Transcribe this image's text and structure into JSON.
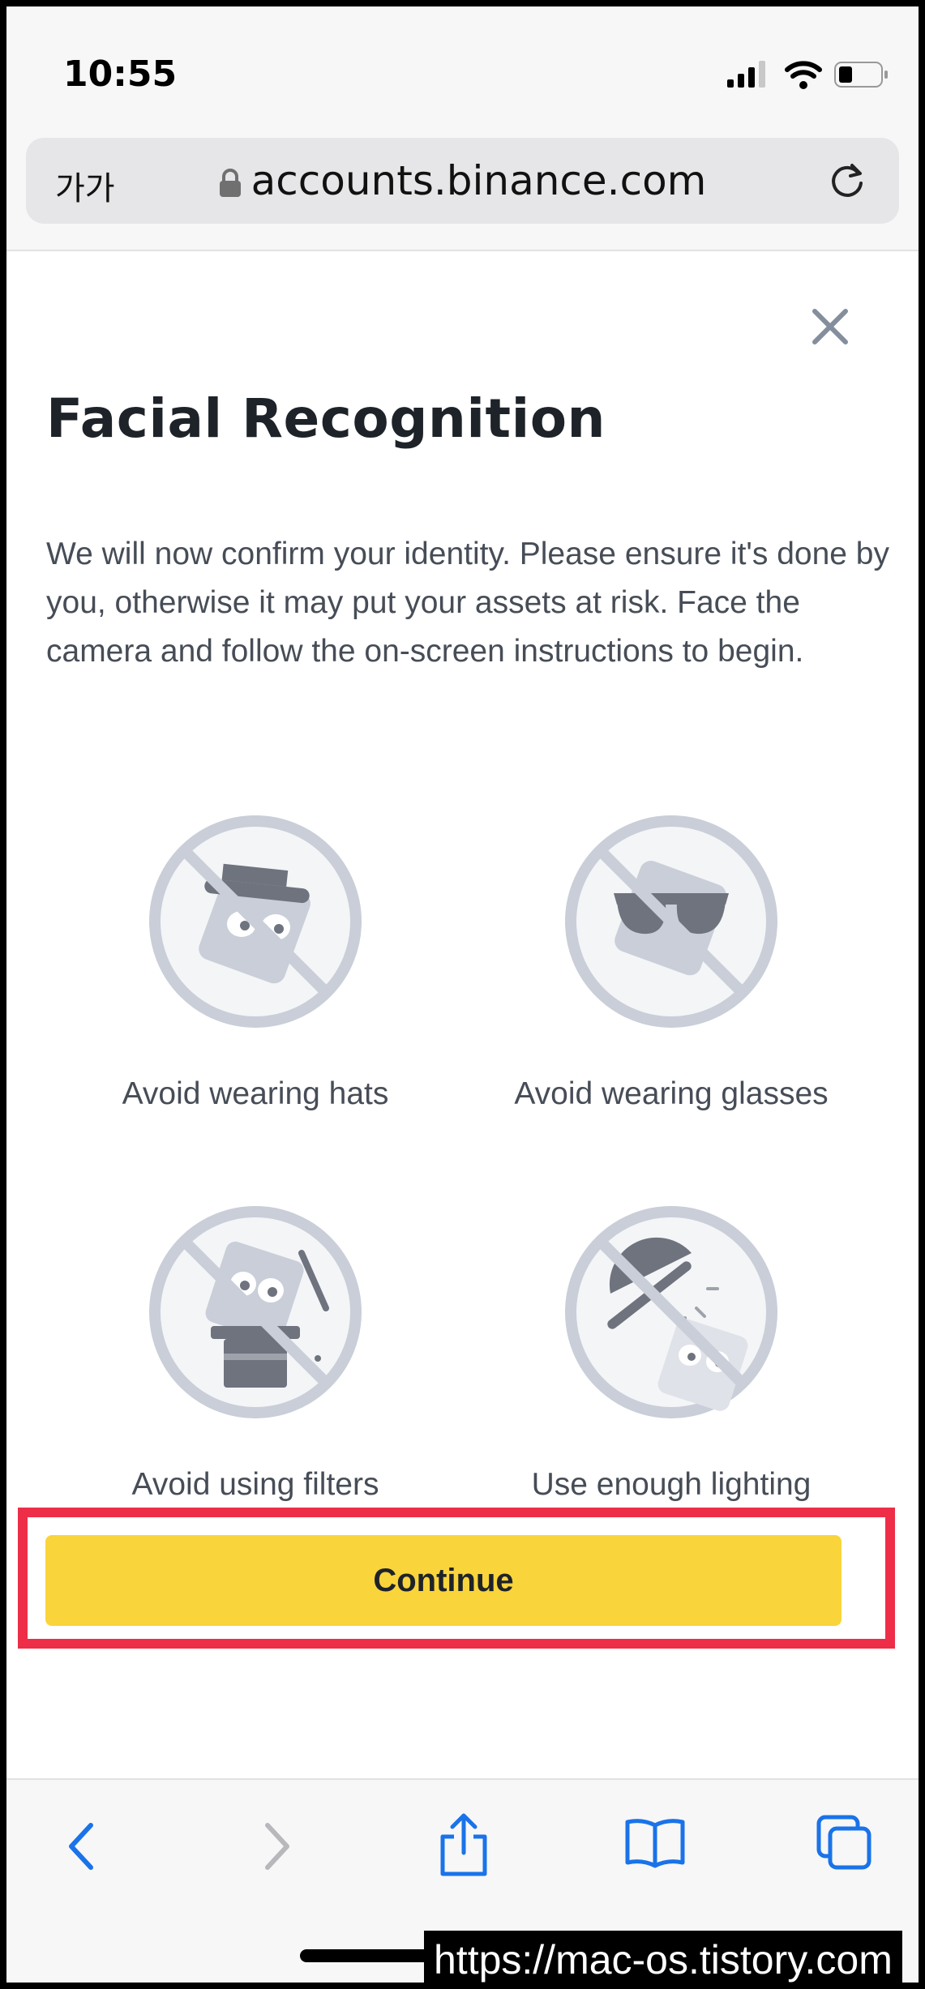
{
  "status_bar": {
    "time": "10:55"
  },
  "address_bar": {
    "text_size_label": "가가",
    "url": "accounts.binance.com"
  },
  "modal": {
    "title": "Facial Recognition",
    "description": "We will now confirm your identity. Please ensure it's done by you, otherwise it may put your assets at risk. Face the camera and follow the on-screen instructions to begin.",
    "tips": [
      {
        "label": "Avoid wearing hats",
        "icon": "no-hat-icon"
      },
      {
        "label": "Avoid wearing glasses",
        "icon": "no-glasses-icon"
      },
      {
        "label": "Avoid using filters",
        "icon": "no-filters-icon"
      },
      {
        "label": "Use enough lighting",
        "icon": "lighting-icon"
      }
    ],
    "continue_label": "Continue"
  },
  "colors": {
    "accent": "#f9d43b",
    "highlight": "#ee2e48",
    "link_blue": "#1a73e8"
  },
  "watermark": "https://mac-os.tistory.com"
}
